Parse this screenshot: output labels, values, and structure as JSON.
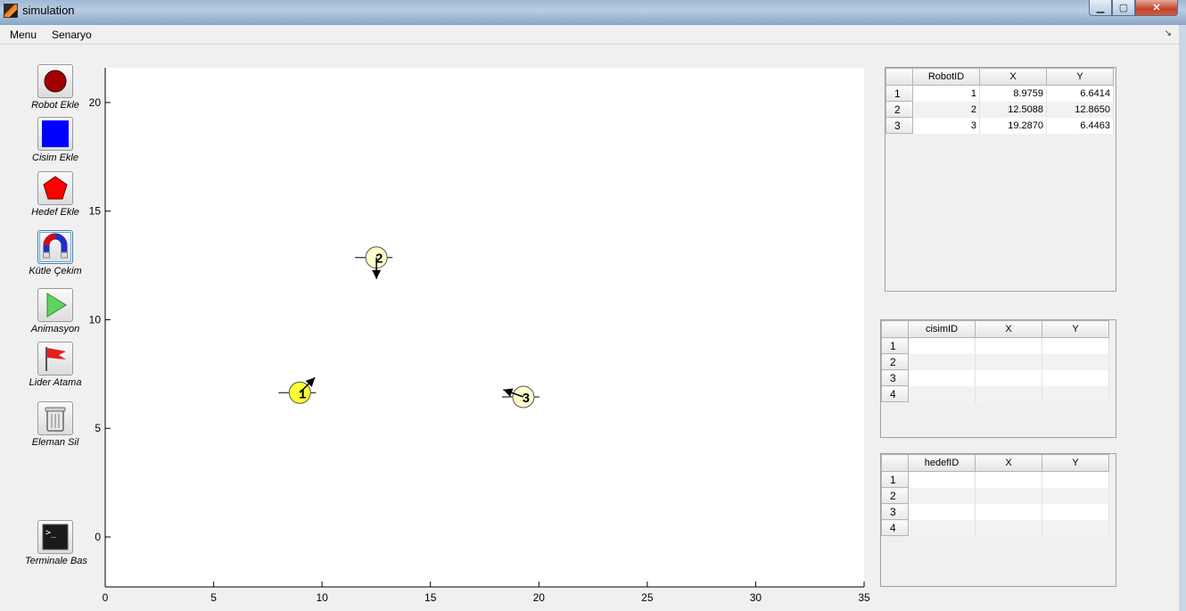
{
  "window": {
    "title": "simulation"
  },
  "menu": {
    "items": [
      "Menu",
      "Senaryo"
    ]
  },
  "toolbar": {
    "robot_ekle": "Robot Ekle",
    "cisim_ekle": "Cisim Ekle",
    "hedef_ekle": "Hedef Ekle",
    "kutle_cekim": "Kütle Çekim",
    "animasyon": "Animasyon",
    "lider_atama": "Lider Atama",
    "eleman_sil": "Eleman Sil",
    "terminale_bas": "Terminale Bas"
  },
  "chart_data": {
    "type": "scatter",
    "xlim": [
      0,
      35
    ],
    "ylim": [
      -2.3,
      21.6
    ],
    "x_ticks": [
      0,
      5,
      10,
      15,
      20,
      25,
      30,
      35
    ],
    "y_ticks": [
      0,
      5,
      10,
      15,
      20
    ],
    "robots": [
      {
        "label": "1",
        "x": 8.9759,
        "y": 6.6414,
        "heading_deg": 45,
        "leader": true
      },
      {
        "label": "2",
        "x": 12.5088,
        "y": 12.865,
        "heading_deg": -90,
        "leader": false
      },
      {
        "label": "3",
        "x": 19.287,
        "y": 6.4463,
        "heading_deg": 160,
        "leader": false
      }
    ]
  },
  "robot_table": {
    "columns": [
      "RobotID",
      "X",
      "Y"
    ],
    "rows": [
      [
        "1",
        "8.9759",
        "6.6414"
      ],
      [
        "2",
        "12.5088",
        "12.8650"
      ],
      [
        "3",
        "19.2870",
        "6.4463"
      ]
    ],
    "row_labels": [
      "1",
      "2",
      "3"
    ]
  },
  "cisim_table": {
    "columns": [
      "cisimID",
      "X",
      "Y"
    ],
    "row_labels": [
      "1",
      "2",
      "3",
      "4"
    ]
  },
  "hedef_table": {
    "columns": [
      "hedefID",
      "X",
      "Y"
    ],
    "row_labels": [
      "1",
      "2",
      "3",
      "4"
    ]
  },
  "colors": {
    "leader_robot": "#ffff33",
    "robot": "#ffffcc",
    "robot_button": "#a00000",
    "cisim_button": "#0000ff",
    "hedef_button": "#ff0000"
  }
}
